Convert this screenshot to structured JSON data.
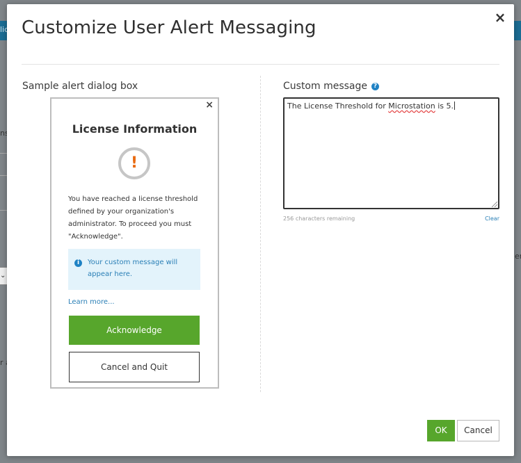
{
  "background": {
    "fragments": [
      "lic",
      "ns",
      "er",
      "r a"
    ],
    "select_glyph": "⌄"
  },
  "modal": {
    "title": "Customize User Alert Messaging",
    "close_glyph": "×"
  },
  "sample": {
    "section_label": "Sample alert dialog box",
    "close_glyph": "×",
    "title": "License Information",
    "warning_glyph": "!",
    "body": "You have reached a license threshold defined by your organization's administrator. To proceed you must \"Acknowledge\".",
    "info_glyph": "i",
    "info_text": "Your custom message will appear here.",
    "learn_more": "Learn more...",
    "acknowledge_label": "Acknowledge",
    "cancel_quit_label": "Cancel and Quit"
  },
  "custom": {
    "section_label": "Custom message",
    "help_glyph": "?",
    "message_prefix": "The License Threshold for ",
    "message_misspelled": "Microstation",
    "message_suffix": " is 5.",
    "chars_remaining": "256 characters remaining",
    "clear_label": "Clear"
  },
  "footer": {
    "ok_label": "OK",
    "cancel_label": "Cancel"
  },
  "colors": {
    "primary_green": "#57a62c",
    "link_blue": "#2a7fb6",
    "warning_orange": "#e96a10",
    "info_bg": "#e3f3fb",
    "topbar_blue": "#1b6c93"
  }
}
